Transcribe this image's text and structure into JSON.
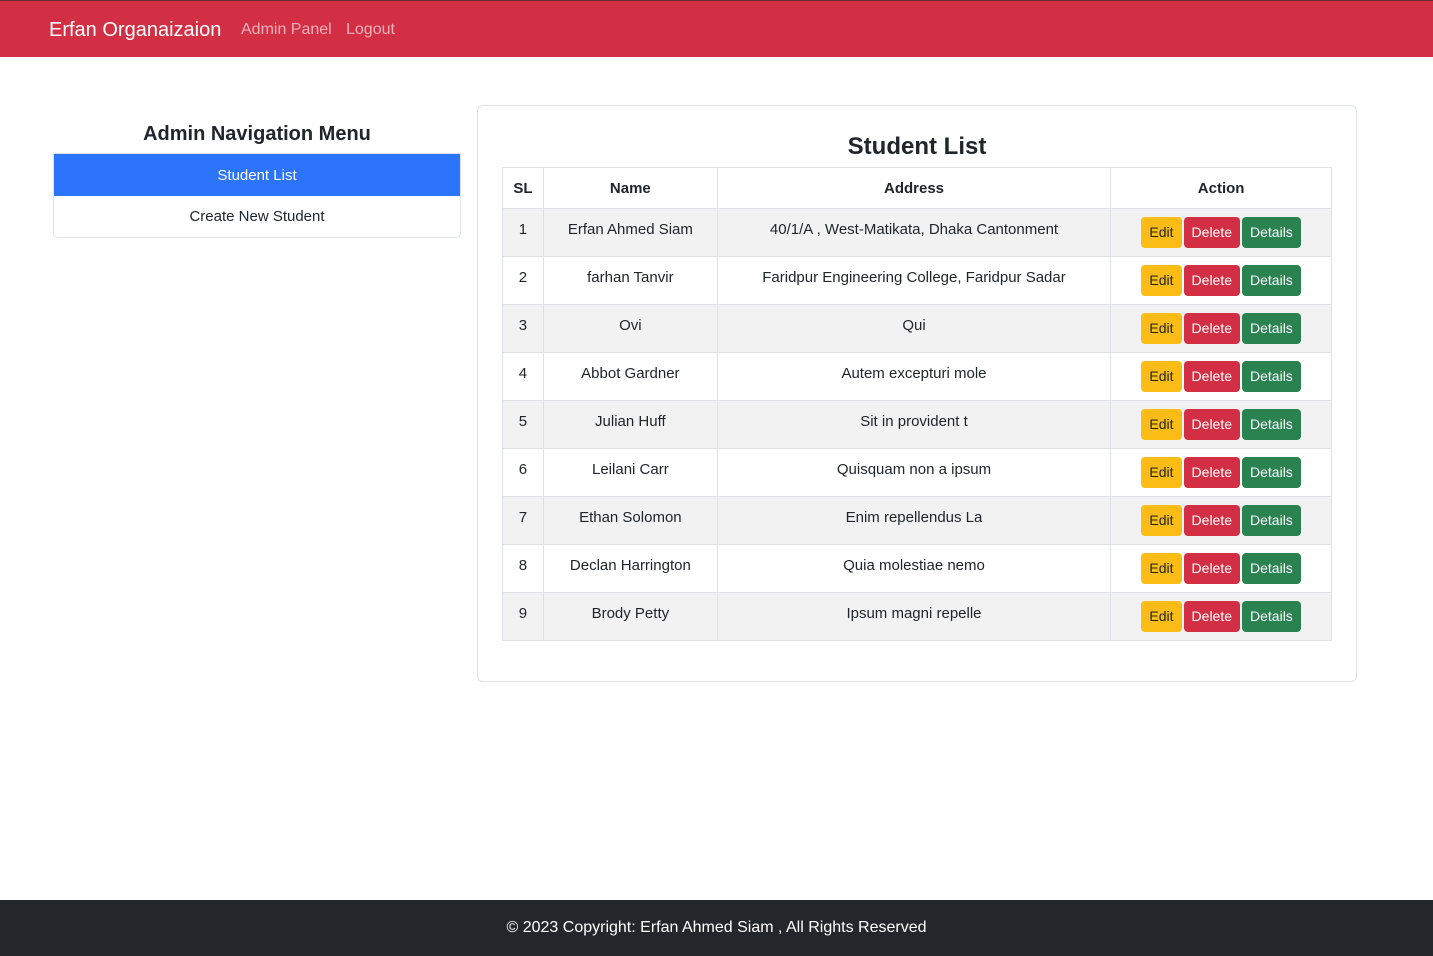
{
  "navbar": {
    "brand": "Erfan Organaizaion",
    "links": [
      "Admin Panel",
      "Logout"
    ]
  },
  "sidebar": {
    "title": "Admin Navigation Menu",
    "items": [
      "Student List",
      "Create New Student"
    ]
  },
  "main": {
    "title": "Student List",
    "columns": [
      "SL",
      "Name",
      "Address",
      "Action"
    ],
    "actions": {
      "edit": "Edit",
      "delete": "Delete",
      "details": "Details"
    },
    "rows": [
      {
        "sl": "1",
        "name": "Erfan Ahmed Siam",
        "address": "40/1/A , West-Matikata, Dhaka Cantonment"
      },
      {
        "sl": "2",
        "name": "farhan Tanvir",
        "address": "Faridpur Engineering College, Faridpur Sadar"
      },
      {
        "sl": "3",
        "name": "Ovi",
        "address": "Qui"
      },
      {
        "sl": "4",
        "name": "Abbot Gardner",
        "address": "Autem excepturi mole"
      },
      {
        "sl": "5",
        "name": "Julian Huff",
        "address": "Sit in provident t"
      },
      {
        "sl": "6",
        "name": "Leilani Carr",
        "address": "Quisquam non a ipsum"
      },
      {
        "sl": "7",
        "name": "Ethan Solomon",
        "address": "Enim repellendus La"
      },
      {
        "sl": "8",
        "name": "Declan Harrington",
        "address": "Quia molestiae nemo"
      },
      {
        "sl": "9",
        "name": "Brody Petty",
        "address": "Ipsum magni repelle"
      }
    ]
  },
  "footer": {
    "text": "© 2023 Copyright: Erfan Ahmed Siam , All Rights Reserved"
  },
  "colors": {
    "navbar": "#d32f44",
    "active": "#2d74fc",
    "edit": "#fbbc16",
    "delete": "#d32f44",
    "details": "#2b8251",
    "footer": "#23272c"
  }
}
